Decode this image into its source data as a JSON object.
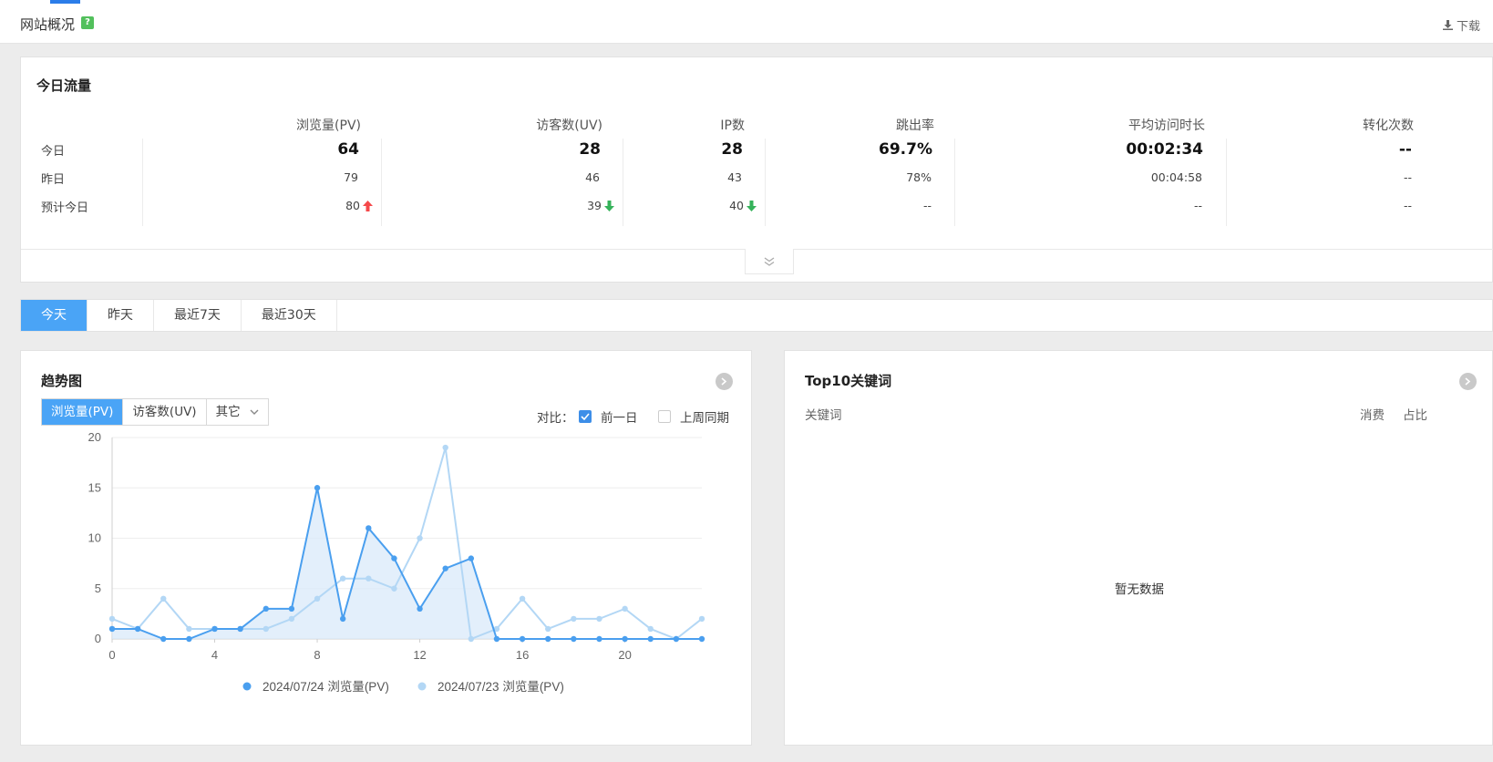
{
  "header": {
    "title": "网站概况",
    "help": "?",
    "download": "下载"
  },
  "traffic": {
    "title": "今日流量",
    "columns": [
      "浏览量(PV)",
      "访客数(UV)",
      "IP数",
      "跳出率",
      "平均访问时长",
      "转化次数"
    ],
    "rows": [
      {
        "label": "今日",
        "values": [
          "64",
          "28",
          "28",
          "69.7%",
          "00:02:34",
          "--"
        ]
      },
      {
        "label": "昨日",
        "values": [
          "79",
          "46",
          "43",
          "78%",
          "00:04:58",
          "--"
        ]
      },
      {
        "label": "预计今日",
        "values": [
          "80",
          "39",
          "40",
          "--",
          "--",
          "--"
        ],
        "trends": [
          "up",
          "down",
          "down",
          "",
          "",
          ""
        ]
      }
    ],
    "colors": {
      "up": "#f5484a",
      "down": "#35b25a"
    }
  },
  "range_tabs": [
    "今天",
    "昨天",
    "最近7天",
    "最近30天"
  ],
  "trend": {
    "title": "趋势图",
    "metric_tabs": [
      "浏览量(PV)",
      "访客数(UV)",
      "其它"
    ],
    "compare_label": "对比：",
    "compare_options": [
      {
        "label": "前一日",
        "checked": true
      },
      {
        "label": "上周同期",
        "checked": false
      }
    ]
  },
  "keywords": {
    "title": "Top10关键词",
    "columns": [
      "关键词",
      "消费",
      "占比"
    ],
    "empty": "暂无数据"
  },
  "chart_data": {
    "type": "line",
    "x": [
      0,
      1,
      2,
      3,
      4,
      5,
      6,
      7,
      8,
      9,
      10,
      11,
      12,
      13,
      14,
      15,
      16,
      17,
      18,
      19,
      20,
      21,
      22,
      23
    ],
    "x_ticks": [
      0,
      4,
      8,
      12,
      16,
      20
    ],
    "ylim": [
      0,
      20
    ],
    "y_ticks": [
      0,
      5,
      10,
      15,
      20
    ],
    "grid": true,
    "legend_position": "bottom",
    "series": [
      {
        "name": "2024/07/24 浏览量(PV)",
        "color": "#4a9fef",
        "fill": true,
        "values": [
          1,
          1,
          0,
          0,
          1,
          1,
          3,
          3,
          15,
          2,
          11,
          8,
          3,
          7,
          8,
          0,
          0,
          0,
          0,
          0,
          0,
          0,
          0,
          0
        ]
      },
      {
        "name": "2024/07/23 浏览量(PV)",
        "color": "#b3d7f5",
        "fill": false,
        "values": [
          2,
          1,
          4,
          1,
          1,
          1,
          1,
          2,
          4,
          6,
          6,
          5,
          10,
          19,
          0,
          1,
          4,
          1,
          2,
          2,
          3,
          1,
          0,
          2
        ]
      }
    ]
  }
}
